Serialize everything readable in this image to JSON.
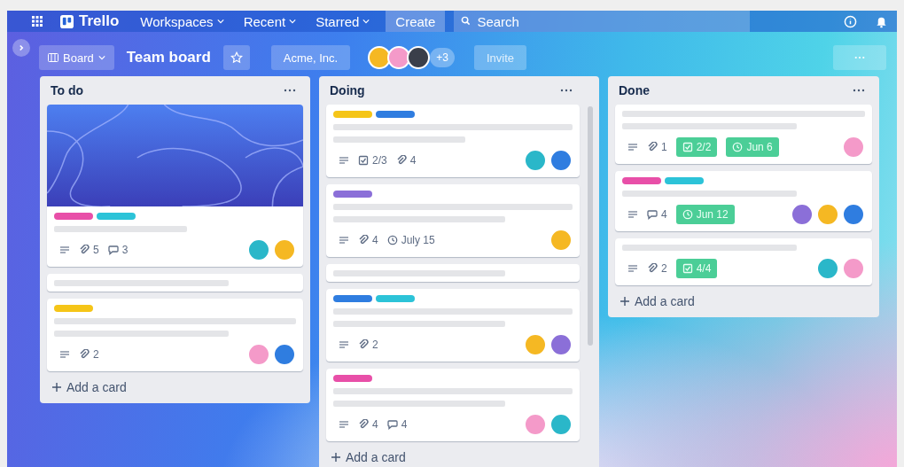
{
  "top_nav": {
    "logo": "Trello",
    "menus": [
      {
        "label": "Workspaces"
      },
      {
        "label": "Recent"
      },
      {
        "label": "Starred"
      }
    ],
    "create_button": "Create",
    "search": {
      "placeholder": "Search"
    }
  },
  "board_header": {
    "view_button": "Board",
    "title": "Team board",
    "workspace": "Acme, Inc.",
    "members": [
      {
        "color": "#f5b823"
      },
      {
        "color": "#f49ac9"
      },
      {
        "color": "#3a3f4a"
      }
    ],
    "more_members": "+3",
    "invite_button": "Invite"
  },
  "lists": [
    {
      "title": "To do",
      "add_card": "Add a card",
      "cards": [
        {
          "cover": true,
          "labels": [
            {
              "color": "#e84fa8"
            },
            {
              "color": "#2cc3d8"
            }
          ],
          "lines": [
            {
              "kind": "short"
            }
          ],
          "badges": [
            {
              "kind": "description"
            },
            {
              "kind": "attachments",
              "text": "5"
            },
            {
              "kind": "comments",
              "text": "3"
            }
          ],
          "members": [
            {
              "color": "#2ab7c9"
            },
            {
              "color": "#f5b823"
            }
          ]
        },
        {
          "lines": [
            {
              "kind": "medium"
            }
          ]
        },
        {
          "labels": [
            {
              "color": "#f5c518"
            }
          ],
          "lines": [
            {
              "kind": "long"
            },
            {
              "kind": "medium"
            }
          ],
          "badges": [
            {
              "kind": "description"
            },
            {
              "kind": "attachments",
              "text": "2"
            }
          ],
          "members": [
            {
              "color": "#f49ac9"
            },
            {
              "color": "#2f7de0"
            }
          ]
        }
      ]
    },
    {
      "title": "Doing",
      "add_card": "Add a card",
      "cards": [
        {
          "labels": [
            {
              "color": "#f5c518"
            },
            {
              "color": "#2f7de0"
            }
          ],
          "lines": [
            {
              "kind": "long"
            },
            {
              "kind": "short"
            }
          ],
          "badges": [
            {
              "kind": "description"
            },
            {
              "kind": "checklist",
              "text": "2/3",
              "complete": false
            },
            {
              "kind": "attachments",
              "text": "4"
            }
          ],
          "members": [
            {
              "color": "#2ab7c9"
            },
            {
              "color": "#2f7de0"
            }
          ]
        },
        {
          "labels": [
            {
              "color": "#8b6fd8"
            }
          ],
          "lines": [
            {
              "kind": "long"
            },
            {
              "kind": "medium"
            }
          ],
          "badges": [
            {
              "kind": "description"
            },
            {
              "kind": "attachments",
              "text": "4"
            },
            {
              "kind": "due",
              "text": "July 15",
              "complete": false
            }
          ],
          "members": [
            {
              "color": "#f5b823"
            }
          ]
        },
        {
          "lines": [
            {
              "kind": "medium"
            }
          ]
        },
        {
          "labels": [
            {
              "color": "#2f7de0"
            },
            {
              "color": "#2cc3d8"
            }
          ],
          "lines": [
            {
              "kind": "long"
            },
            {
              "kind": "medium"
            }
          ],
          "badges": [
            {
              "kind": "description"
            },
            {
              "kind": "attachments",
              "text": "2"
            }
          ],
          "members": [
            {
              "color": "#f5b823"
            },
            {
              "color": "#8b6fd8"
            }
          ]
        },
        {
          "labels": [
            {
              "color": "#e84fa8"
            }
          ],
          "lines": [
            {
              "kind": "long"
            },
            {
              "kind": "medium"
            }
          ],
          "badges": [
            {
              "kind": "description"
            },
            {
              "kind": "attachments",
              "text": "4"
            },
            {
              "kind": "comments",
              "text": "4"
            }
          ],
          "members": [
            {
              "color": "#f49ac9"
            },
            {
              "color": "#2ab7c9"
            }
          ]
        }
      ]
    },
    {
      "title": "Done",
      "add_card": "Add a card",
      "cards": [
        {
          "lines": [
            {
              "kind": "long"
            },
            {
              "kind": "medium"
            }
          ],
          "badges": [
            {
              "kind": "description"
            },
            {
              "kind": "attachments",
              "text": "1"
            },
            {
              "kind": "checklist",
              "text": "2/2",
              "complete": true
            },
            {
              "kind": "due",
              "text": "Jun 6",
              "complete": true
            }
          ],
          "members": [
            {
              "color": "#f49ac9"
            }
          ]
        },
        {
          "labels": [
            {
              "color": "#e84fa8"
            },
            {
              "color": "#2cc3d8"
            }
          ],
          "lines": [
            {
              "kind": "medium"
            }
          ],
          "badges": [
            {
              "kind": "description"
            },
            {
              "kind": "comments",
              "text": "4"
            },
            {
              "kind": "due",
              "text": "Jun 12",
              "complete": true
            }
          ],
          "members": [
            {
              "color": "#8b6fd8"
            },
            {
              "color": "#f5b823"
            },
            {
              "color": "#2f7de0"
            }
          ]
        },
        {
          "lines": [
            {
              "kind": "medium"
            }
          ],
          "badges": [
            {
              "kind": "description"
            },
            {
              "kind": "attachments",
              "text": "2"
            },
            {
              "kind": "checklist",
              "text": "4/4",
              "complete": true
            }
          ],
          "members": [
            {
              "color": "#2ab7c9"
            },
            {
              "color": "#f49ac9"
            }
          ]
        }
      ]
    }
  ]
}
